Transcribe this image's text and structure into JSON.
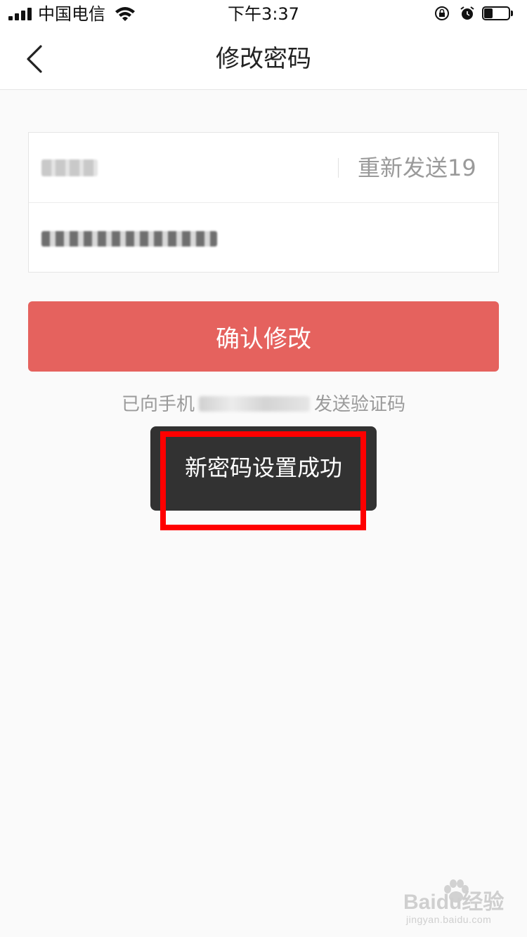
{
  "status_bar": {
    "carrier": "中国电信",
    "time": "下午3:37",
    "battery_level": 0.35,
    "icons": [
      "signal-icon",
      "wifi-icon",
      "rotation-lock-icon",
      "alarm-icon",
      "battery-icon"
    ]
  },
  "nav": {
    "back_icon": "chevron-left-icon",
    "title": "修改密码"
  },
  "form": {
    "verification_code_value": "",
    "new_password_value": "",
    "resend_label": "重新发送19"
  },
  "confirm_button": {
    "label": "确认修改",
    "color": "#e5625e"
  },
  "hint": {
    "prefix": "已向手机",
    "suffix": "发送验证码"
  },
  "toast": {
    "message": "新密码设置成功",
    "highlight_color": "#ff0000"
  },
  "watermark": {
    "main_text": "Bai",
    "main_text_2": "du",
    "main_text_3": "经验",
    "sub_text": "jingyan.baidu.com"
  }
}
